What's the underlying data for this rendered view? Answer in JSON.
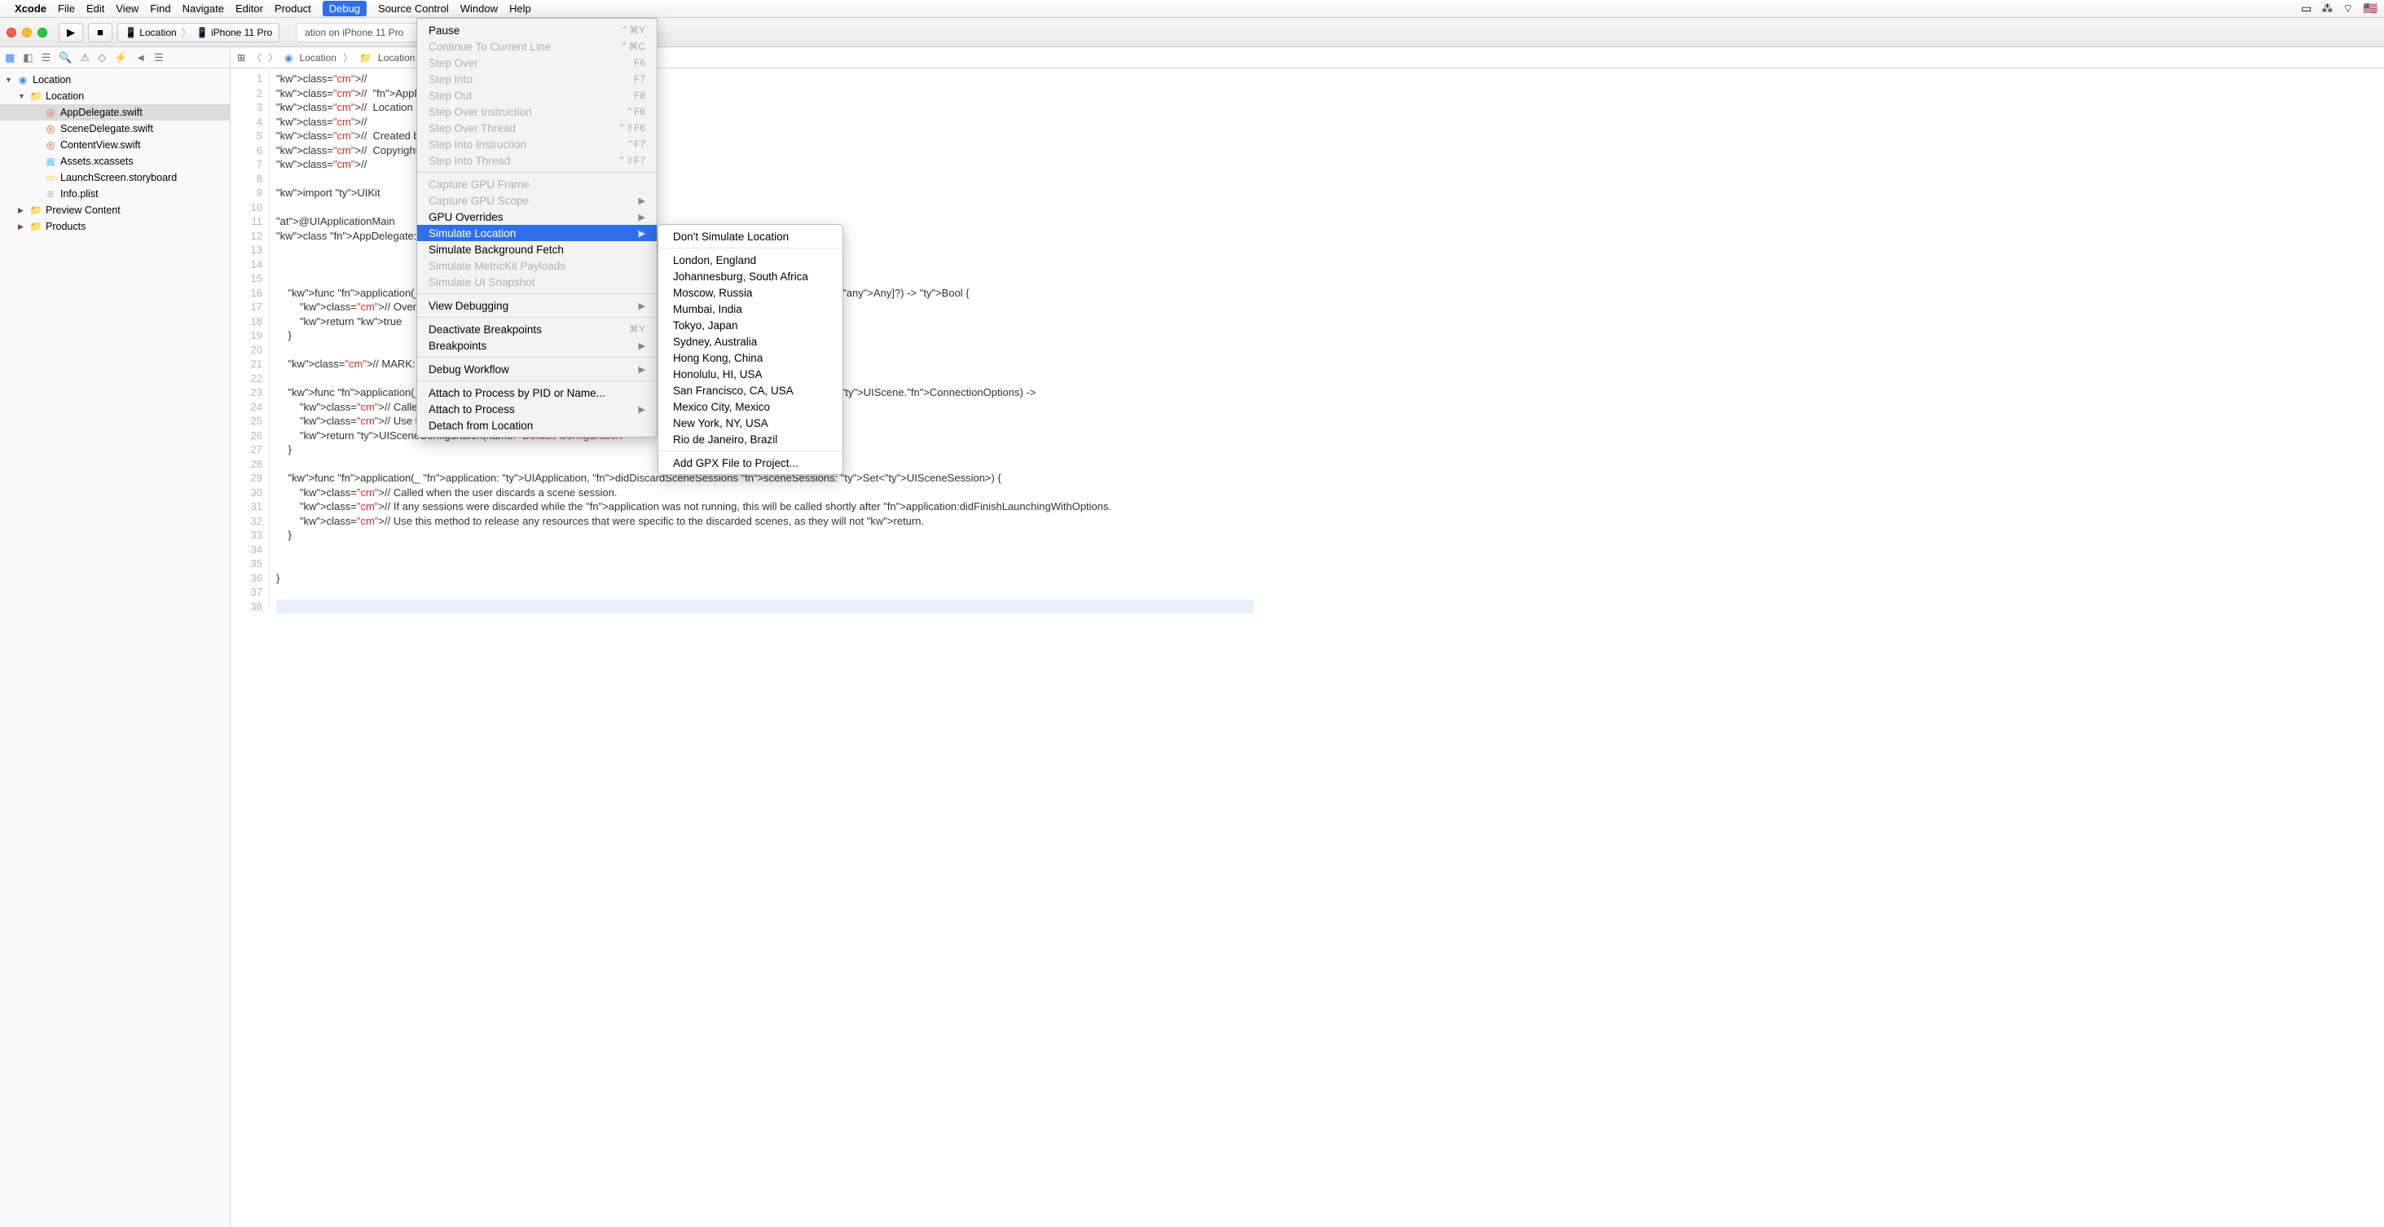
{
  "menubar": {
    "app": "Xcode",
    "items": [
      "File",
      "Edit",
      "View",
      "Find",
      "Navigate",
      "Editor",
      "Product",
      "Debug",
      "Source Control",
      "Window",
      "Help"
    ],
    "active": "Debug"
  },
  "toolbar": {
    "scheme_app": "Location",
    "scheme_device": "iPhone 11 Pro",
    "status": "ation on iPhone 11 Pro"
  },
  "jumpbar": {
    "proj": "Location",
    "folder": "Location"
  },
  "navigator": {
    "root": "Location",
    "group": "Location",
    "files": [
      {
        "name": "AppDelegate.swift",
        "icon": "swift",
        "selected": true
      },
      {
        "name": "SceneDelegate.swift",
        "icon": "swift"
      },
      {
        "name": "ContentView.swift",
        "icon": "swift"
      },
      {
        "name": "Assets.xcassets",
        "icon": "assets"
      },
      {
        "name": "LaunchScreen.storyboard",
        "icon": "sb"
      },
      {
        "name": "Info.plist",
        "icon": "plist"
      }
    ],
    "folders": [
      {
        "name": "Preview Content"
      },
      {
        "name": "Products"
      }
    ]
  },
  "debug_menu": [
    {
      "label": "Pause",
      "shortcut": "⌃⌘Y"
    },
    {
      "label": "Continue To Current Line",
      "shortcut": "⌃⌘C",
      "disabled": true
    },
    {
      "label": "Step Over",
      "shortcut": "F6",
      "disabled": true
    },
    {
      "label": "Step Into",
      "shortcut": "F7",
      "disabled": true
    },
    {
      "label": "Step Out",
      "shortcut": "F8",
      "disabled": true
    },
    {
      "label": "Step Over Instruction",
      "shortcut": "⌃F6",
      "disabled": true
    },
    {
      "label": "Step Over Thread",
      "shortcut": "⌃⇧F6",
      "disabled": true
    },
    {
      "label": "Step Into Instruction",
      "shortcut": "⌃F7",
      "disabled": true
    },
    {
      "label": "Step Into Thread",
      "shortcut": "⌃⇧F7",
      "disabled": true
    },
    {
      "sep": true
    },
    {
      "label": "Capture GPU Frame",
      "disabled": true
    },
    {
      "label": "Capture GPU Scope",
      "submenu": true,
      "disabled": true
    },
    {
      "label": "GPU Overrides",
      "submenu": true
    },
    {
      "label": "Simulate Location",
      "submenu": true,
      "highlight": true
    },
    {
      "label": "Simulate Background Fetch"
    },
    {
      "label": "Simulate MetricKit Payloads",
      "disabled": true
    },
    {
      "label": "Simulate UI Snapshot",
      "disabled": true
    },
    {
      "sep": true
    },
    {
      "label": "View Debugging",
      "submenu": true
    },
    {
      "sep": true
    },
    {
      "label": "Deactivate Breakpoints",
      "shortcut": "⌘Y"
    },
    {
      "label": "Breakpoints",
      "submenu": true
    },
    {
      "sep": true
    },
    {
      "label": "Debug Workflow",
      "submenu": true
    },
    {
      "sep": true
    },
    {
      "label": "Attach to Process by PID or Name..."
    },
    {
      "label": "Attach to Process",
      "submenu": true
    },
    {
      "label": "Detach from Location"
    }
  ],
  "location_submenu": {
    "top": "Don't Simulate Location",
    "cities": [
      "London, England",
      "Johannesburg, South Africa",
      "Moscow, Russia",
      "Mumbai, India",
      "Tokyo, Japan",
      "Sydney, Australia",
      "Hong Kong, China",
      "Honolulu, HI, USA",
      "San Francisco, CA, USA",
      "Mexico City, Mexico",
      "New York, NY, USA",
      "Rio de Janeiro, Brazil"
    ],
    "bottom": "Add GPX File to Project..."
  },
  "code": {
    "lines": [
      "//",
      "//  AppDelegate.swift",
      "//  Location",
      "//",
      "//  Created by Daniil M",
      "//  Copyright © 2020 Da",
      "//",
      "",
      "import UIKit",
      "",
      "@UIApplicationMain",
      "class AppDelegate: UIRe",
      "",
      "",
      "",
      "    func application(_ ap                                                                s: [UIApplication.LaunchOptionsKey: Any]?) -> Bool {",
      "        // Override point f",
      "        return true",
      "    }",
      "",
      "    // MARK: UISceneSess",
      "",
      "    func application(_ ap                                                                eSession: UISceneSession, options: UIScene.ConnectionOptions) ->",
      "        // Called when a ne",
      "        // Use this method",
      "        return UISceneConfiguration(name: \"Default Configuration\"                      eSession.role)",
      "    }",
      "",
      "    func application(_ application: UIApplication, didDiscardSceneSessions sceneSessions: Set<UISceneSession>) {",
      "        // Called when the user discards a scene session.",
      "        // If any sessions were discarded while the application was not running, this will be called shortly after application:didFinishLaunchingWithOptions.",
      "        // Use this method to release any resources that were specific to the discarded scenes, as they will not return.",
      "    }",
      "",
      "",
      "}",
      "",
      ""
    ]
  }
}
